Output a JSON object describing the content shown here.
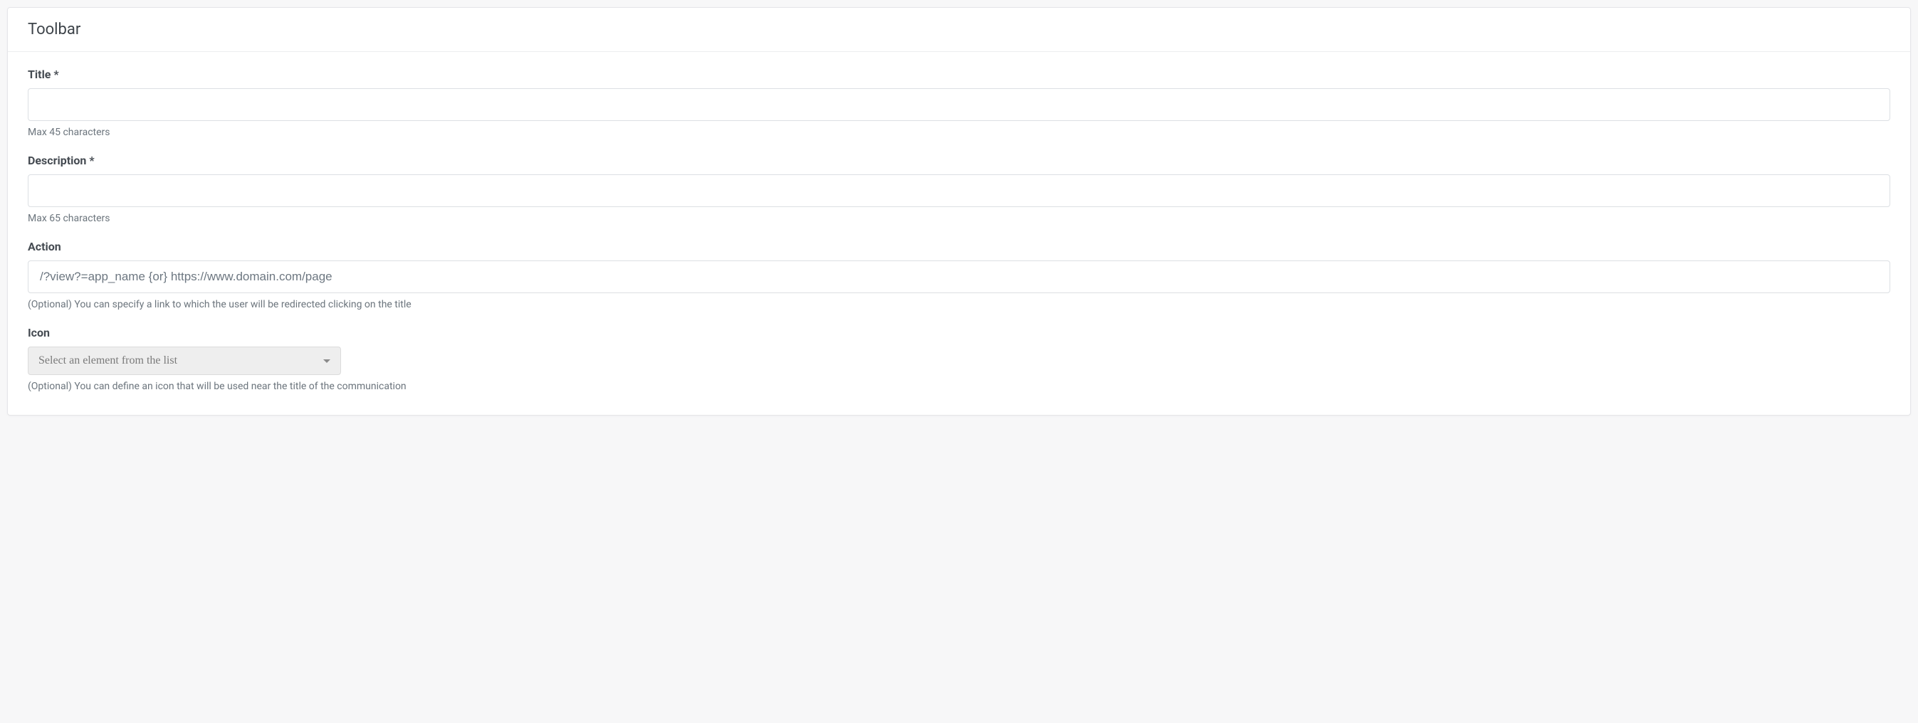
{
  "header": {
    "title": "Toolbar"
  },
  "form": {
    "title": {
      "label": "Title *",
      "value": "",
      "help": "Max 45 characters"
    },
    "description": {
      "label": "Description *",
      "value": "",
      "help": "Max 65 characters"
    },
    "action": {
      "label": "Action",
      "value": "",
      "placeholder": "/?view?=app_name {or} https://www.domain.com/page",
      "help": "(Optional) You can specify a link to which the user will be redirected clicking on the title"
    },
    "icon": {
      "label": "Icon",
      "placeholder": "Select an element from the list",
      "help": "(Optional) You can define an icon that will be used near the title of the communication"
    }
  }
}
